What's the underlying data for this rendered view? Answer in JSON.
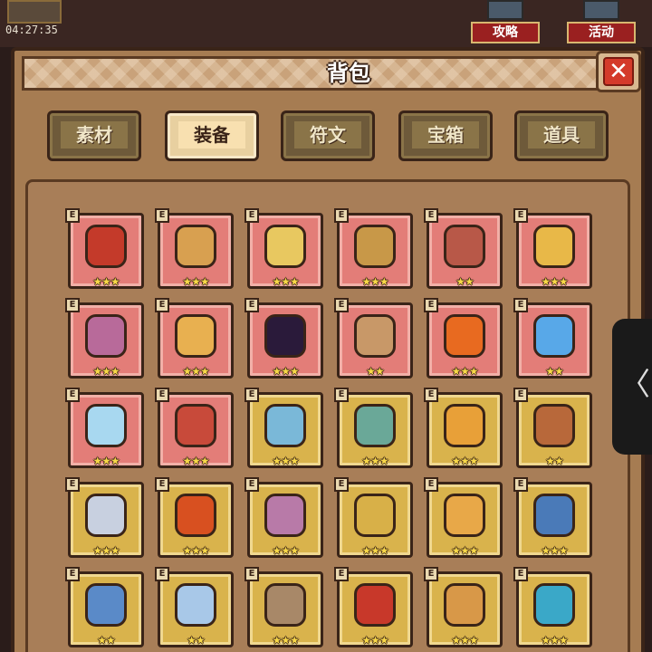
{
  "clock": "04:27:35",
  "top_buttons": [
    {
      "label": "攻略",
      "icon": "chat-bubble-icon"
    },
    {
      "label": "活动",
      "icon": "event-icon"
    }
  ],
  "panel": {
    "title": "背包",
    "close_label": "✕"
  },
  "tabs": [
    {
      "label": "素材",
      "active": false
    },
    {
      "label": "装备",
      "active": true
    },
    {
      "label": "符文",
      "active": false
    },
    {
      "label": "宝箱",
      "active": false
    },
    {
      "label": "道具",
      "active": false
    }
  ],
  "badge_label": "E",
  "side_handle_label": "〈",
  "items": [
    {
      "icon": "crossed-red-blades-icon",
      "rarity": "red",
      "stars": "★★★",
      "color": "#c43a2a"
    },
    {
      "icon": "wooden-staff-icon",
      "rarity": "red",
      "stars": "★★★",
      "color": "#d8a050"
    },
    {
      "icon": "straw-hat-icon",
      "rarity": "red",
      "stars": "★★★",
      "color": "#e8c860"
    },
    {
      "icon": "horned-helmet-icon",
      "rarity": "red",
      "stars": "★★★",
      "color": "#c89848"
    },
    {
      "icon": "tentacle-cloak-icon",
      "rarity": "red",
      "stars": "★★",
      "color": "#b85848"
    },
    {
      "icon": "heart-amulet-icon",
      "rarity": "red",
      "stars": "★★★",
      "color": "#e8b848"
    },
    {
      "icon": "purple-vest-icon",
      "rarity": "red",
      "stars": "★★★",
      "color": "#b86a9a"
    },
    {
      "icon": "gold-ring-icon",
      "rarity": "red",
      "stars": "★★★",
      "color": "#e8b050"
    },
    {
      "icon": "dark-orb-icon",
      "rarity": "red",
      "stars": "★★★",
      "color": "#2a1a3a"
    },
    {
      "icon": "crystal-crown-icon",
      "rarity": "red",
      "stars": "★★",
      "color": "#c89868"
    },
    {
      "icon": "flame-ring-icon",
      "rarity": "red",
      "stars": "★★★",
      "color": "#e86a20"
    },
    {
      "icon": "ice-armor-icon",
      "rarity": "red",
      "stars": "★★",
      "color": "#58a8e8"
    },
    {
      "icon": "lightning-necklace-icon",
      "rarity": "red",
      "stars": "★★★",
      "color": "#a8d8f0"
    },
    {
      "icon": "red-gem-ring-icon",
      "rarity": "red",
      "stars": "★★★",
      "color": "#c84a3a"
    },
    {
      "icon": "ice-dagger-icon",
      "rarity": "gold",
      "stars": "★★★",
      "color": "#7ab8d8"
    },
    {
      "icon": "jade-sword-icon",
      "rarity": "gold",
      "stars": "★★★",
      "color": "#6aa898"
    },
    {
      "icon": "golden-mace-icon",
      "rarity": "gold",
      "stars": "★★★",
      "color": "#e8a038"
    },
    {
      "icon": "ruby-scepter-icon",
      "rarity": "gold",
      "stars": "★★",
      "color": "#b8683a"
    },
    {
      "icon": "crossed-swords-icon",
      "rarity": "gold",
      "stars": "★★★",
      "color": "#c8d0e0"
    },
    {
      "icon": "lava-shield-icon",
      "rarity": "gold",
      "stars": "★★★",
      "color": "#d85020"
    },
    {
      "icon": "round-shield-icon",
      "rarity": "gold",
      "stars": "★★★",
      "color": "#b87aa8"
    },
    {
      "icon": "emerald-bracer-icon",
      "rarity": "gold",
      "stars": "★★★",
      "color": "#d8b048"
    },
    {
      "icon": "golden-spear-icon",
      "rarity": "gold",
      "stars": "★★★",
      "color": "#e8a848"
    },
    {
      "icon": "gem-pendant-icon",
      "rarity": "gold",
      "stars": "★★★",
      "color": "#4a7ab8"
    },
    {
      "icon": "magic-lamp-icon",
      "rarity": "gold",
      "stars": "★★",
      "color": "#5a8ac8"
    },
    {
      "icon": "crystal-shard-icon",
      "rarity": "gold",
      "stars": "★★",
      "color": "#a8c8e8"
    },
    {
      "icon": "feathered-headdress-icon",
      "rarity": "gold",
      "stars": "★★★",
      "color": "#a88868"
    },
    {
      "icon": "furnace-gauntlet-icon",
      "rarity": "gold",
      "stars": "★★★",
      "color": "#c8382a"
    },
    {
      "icon": "horned-circlet-icon",
      "rarity": "gold",
      "stars": "★★★",
      "color": "#d89848"
    },
    {
      "icon": "goggles-icon",
      "rarity": "gold",
      "stars": "★★★",
      "color": "#3aa8c8"
    }
  ]
}
